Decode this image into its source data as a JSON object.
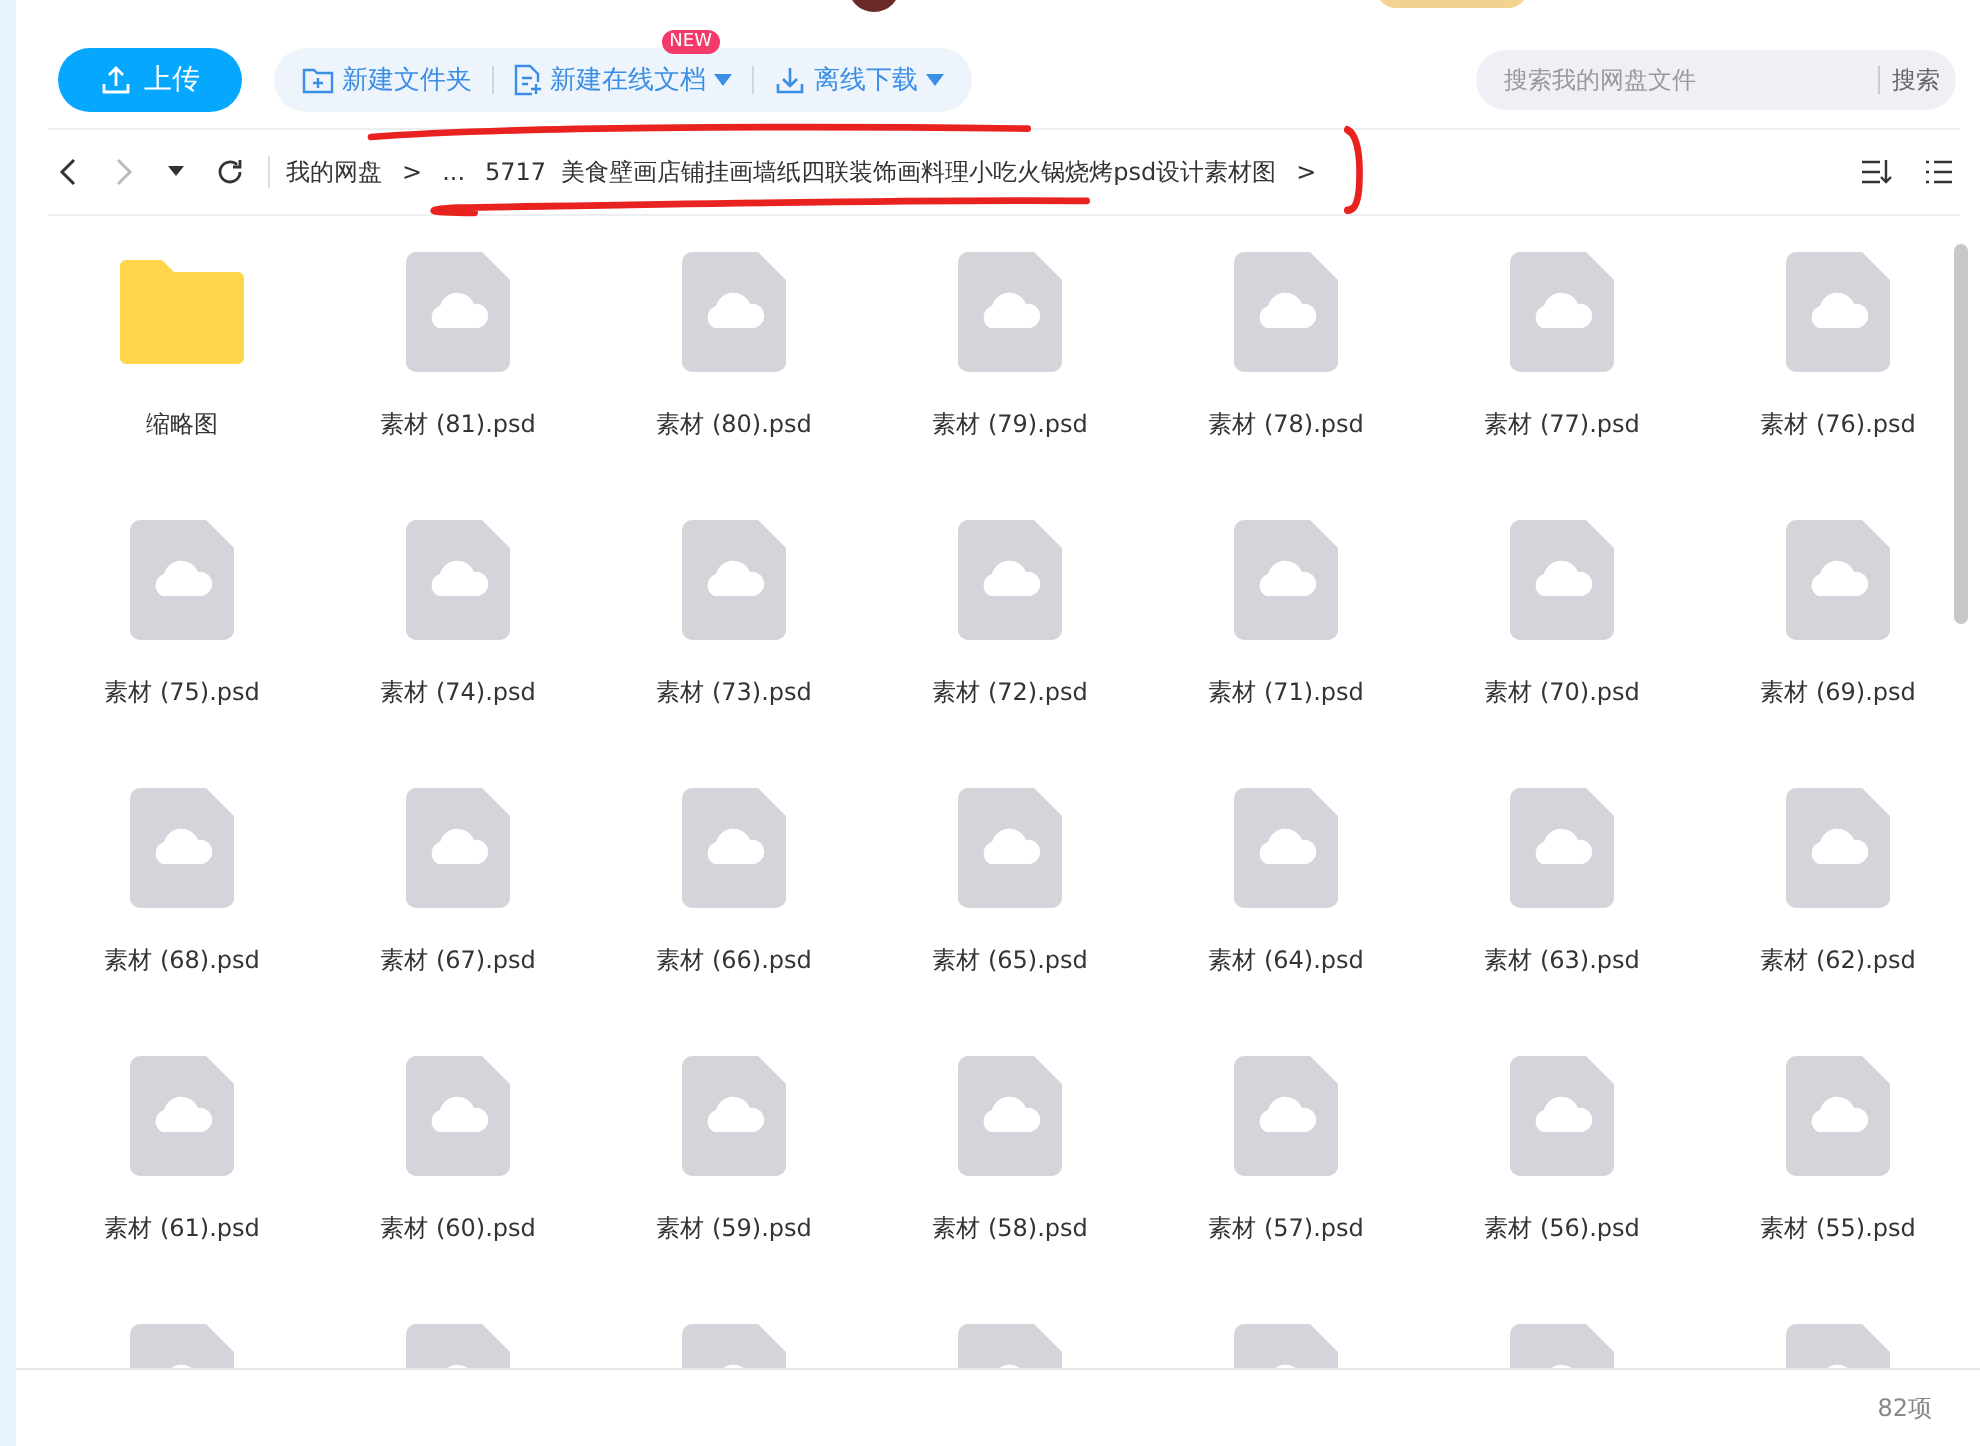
{
  "toolbar": {
    "upload": {
      "label": "上传"
    },
    "tools": [
      {
        "label": "新建文件夹",
        "kind": "folder",
        "dropdown": false
      },
      {
        "label": "新建在线文档",
        "kind": "doc",
        "dropdown": true,
        "badge": "NEW"
      },
      {
        "label": "离线下载",
        "kind": "download",
        "dropdown": true
      }
    ],
    "search": {
      "placeholder": "搜索我的网盘文件",
      "button": "搜索"
    }
  },
  "breadcrumb": {
    "items": [
      "我的网盘",
      ">",
      "...",
      "5717  美食壁画店铺挂画墙纸四联装饰画料理小吃火锅烧烤psd设计素材图",
      ">"
    ]
  },
  "files": [
    {
      "name": "缩略图",
      "kind": "folder"
    },
    {
      "name": "素材 (81).psd",
      "kind": "psd"
    },
    {
      "name": "素材 (80).psd",
      "kind": "psd"
    },
    {
      "name": "素材 (79).psd",
      "kind": "psd"
    },
    {
      "name": "素材 (78).psd",
      "kind": "psd"
    },
    {
      "name": "素材 (77).psd",
      "kind": "psd"
    },
    {
      "name": "素材 (76).psd",
      "kind": "psd"
    },
    {
      "name": "素材 (75).psd",
      "kind": "psd"
    },
    {
      "name": "素材 (74).psd",
      "kind": "psd"
    },
    {
      "name": "素材 (73).psd",
      "kind": "psd"
    },
    {
      "name": "素材 (72).psd",
      "kind": "psd"
    },
    {
      "name": "素材 (71).psd",
      "kind": "psd"
    },
    {
      "name": "素材 (70).psd",
      "kind": "psd"
    },
    {
      "name": "素材 (69).psd",
      "kind": "psd"
    },
    {
      "name": "素材 (68).psd",
      "kind": "psd"
    },
    {
      "name": "素材 (67).psd",
      "kind": "psd"
    },
    {
      "name": "素材 (66).psd",
      "kind": "psd"
    },
    {
      "name": "素材 (65).psd",
      "kind": "psd"
    },
    {
      "name": "素材 (64).psd",
      "kind": "psd"
    },
    {
      "name": "素材 (63).psd",
      "kind": "psd"
    },
    {
      "name": "素材 (62).psd",
      "kind": "psd"
    },
    {
      "name": "素材 (61).psd",
      "kind": "psd"
    },
    {
      "name": "素材 (60).psd",
      "kind": "psd"
    },
    {
      "name": "素材 (59).psd",
      "kind": "psd"
    },
    {
      "name": "素材 (58).psd",
      "kind": "psd"
    },
    {
      "name": "素材 (57).psd",
      "kind": "psd"
    },
    {
      "name": "素材 (56).psd",
      "kind": "psd"
    },
    {
      "name": "素材 (55).psd",
      "kind": "psd"
    },
    {
      "kind": "psd"
    },
    {
      "kind": "psd"
    },
    {
      "kind": "psd"
    },
    {
      "kind": "psd"
    },
    {
      "kind": "psd"
    },
    {
      "kind": "psd"
    },
    {
      "kind": "psd"
    }
  ],
  "status_bar": {
    "count": "82项"
  }
}
